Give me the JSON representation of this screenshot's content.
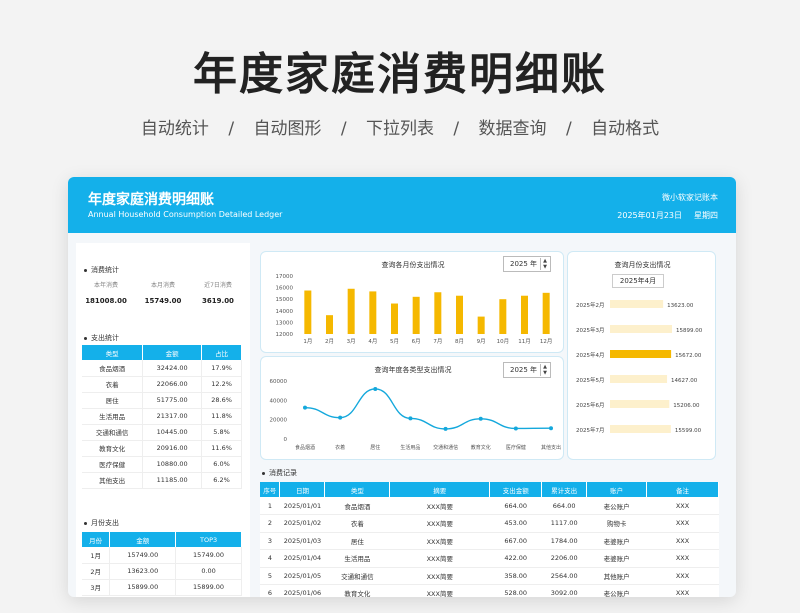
{
  "hero": {
    "title": "年度家庭消费明细账",
    "features": [
      "自动统计",
      "自动图形",
      "下拉列表",
      "数据查询",
      "自动格式"
    ],
    "separator": "/"
  },
  "banner": {
    "title": "年度家庭消费明细账",
    "subtitle": "Annual Household Consumption Detailed Ledger",
    "brand": "微小软家记账本",
    "date": "2025年01月23日",
    "weekday": "星期四",
    "color": "#14b0ea"
  },
  "kpis": {
    "title": "消费统计",
    "items": [
      {
        "label": "本年消费",
        "value": "181008.00"
      },
      {
        "label": "本月消费",
        "value": "15749.00"
      },
      {
        "label": "近7日消费",
        "value": "3619.00"
      }
    ]
  },
  "category_stats": {
    "title": "支出统计",
    "headers": [
      "类型",
      "金额",
      "占比"
    ],
    "rows": [
      [
        "食品烟酒",
        "32424.00",
        "17.9%"
      ],
      [
        "衣着",
        "22066.00",
        "12.2%"
      ],
      [
        "居住",
        "51775.00",
        "28.6%"
      ],
      [
        "生活用品",
        "21317.00",
        "11.8%"
      ],
      [
        "交通和通信",
        "10445.00",
        "5.8%"
      ],
      [
        "教育文化",
        "20916.00",
        "11.6%"
      ],
      [
        "医疗保健",
        "10880.00",
        "6.0%"
      ],
      [
        "其他支出",
        "11185.00",
        "6.2%"
      ]
    ]
  },
  "monthly_stats": {
    "title": "月份支出",
    "headers": [
      "月份",
      "金额",
      "TOP3"
    ],
    "rows": [
      [
        "1月",
        "15749.00",
        "15749.00"
      ],
      [
        "2月",
        "13623.00",
        "0.00"
      ],
      [
        "3月",
        "15899.00",
        "15899.00"
      ]
    ]
  },
  "monthly_chart_card": {
    "title": "查询各月份支出情况",
    "year": "2025 年"
  },
  "category_chart_card": {
    "title": "查询年度各类型支出情况",
    "year": "2025 年"
  },
  "month_query_card": {
    "title": "查询月份支出情况",
    "month": "2025年4月"
  },
  "chart_data": [
    {
      "type": "bar",
      "title": "查询各月份支出情况",
      "categories": [
        "1月",
        "2月",
        "3月",
        "4月",
        "5月",
        "6月",
        "7月",
        "8月",
        "9月",
        "10月",
        "11月",
        "12月"
      ],
      "values": [
        15749,
        13623,
        15899,
        15672,
        14627,
        15206,
        15599,
        15300,
        13500,
        15000,
        15300,
        15550
      ],
      "ylim": [
        12000,
        17000
      ],
      "yticks": [
        "17000",
        "16000",
        "15000",
        "14000",
        "13000",
        "12000"
      ],
      "color": "#f5b800",
      "grid": false
    },
    {
      "type": "line",
      "title": "查询年度各类型支出情况",
      "categories": [
        "食品烟酒",
        "衣着",
        "居住",
        "生活用品",
        "交通和通信",
        "教育文化",
        "医疗保健",
        "其他支出"
      ],
      "values": [
        32424,
        22066,
        51775,
        21317,
        10445,
        20916,
        10880,
        11185
      ],
      "ylim": [
        0,
        60000
      ],
      "yticks": [
        "60000",
        "40000",
        "20000",
        "0"
      ],
      "color": "#14a8dc",
      "smooth": true
    },
    {
      "type": "bar",
      "orientation": "horizontal",
      "title": "查询月份支出情况",
      "categories": [
        "2025年2月",
        "2025年3月",
        "2025年4月",
        "2025年5月",
        "2025年6月",
        "2025年7月"
      ],
      "values": [
        13623,
        15899,
        15672,
        14627,
        15206,
        15599
      ],
      "labels": [
        "13623.00",
        "15899.00",
        "15672.00",
        "14627.00",
        "15206.00",
        "15599.00"
      ],
      "highlight": "2025年4月",
      "colors": {
        "normal": "#fdf0cc",
        "highlight": "#f5b800"
      }
    }
  ],
  "records": {
    "title": "消费记录",
    "headers": [
      "序号",
      "日期",
      "类型",
      "摘要",
      "支出金额",
      "累计支出",
      "账户",
      "备注"
    ],
    "rows": [
      [
        "1",
        "2025/01/01",
        "食品烟酒",
        "XXX简要",
        "664.00",
        "664.00",
        "老公账户",
        "XXX"
      ],
      [
        "2",
        "2025/01/02",
        "衣着",
        "XXX简要",
        "453.00",
        "1117.00",
        "购物卡",
        "XXX"
      ],
      [
        "3",
        "2025/01/03",
        "居住",
        "XXX简要",
        "667.00",
        "1784.00",
        "老婆账户",
        "XXX"
      ],
      [
        "4",
        "2025/01/04",
        "生活用品",
        "XXX简要",
        "422.00",
        "2206.00",
        "老婆账户",
        "XXX"
      ],
      [
        "5",
        "2025/01/05",
        "交通和通信",
        "XXX简要",
        "358.00",
        "2564.00",
        "其他账户",
        "XXX"
      ],
      [
        "6",
        "2025/01/06",
        "教育文化",
        "XXX简要",
        "528.00",
        "3092.00",
        "老公账户",
        "XXX"
      ]
    ]
  }
}
